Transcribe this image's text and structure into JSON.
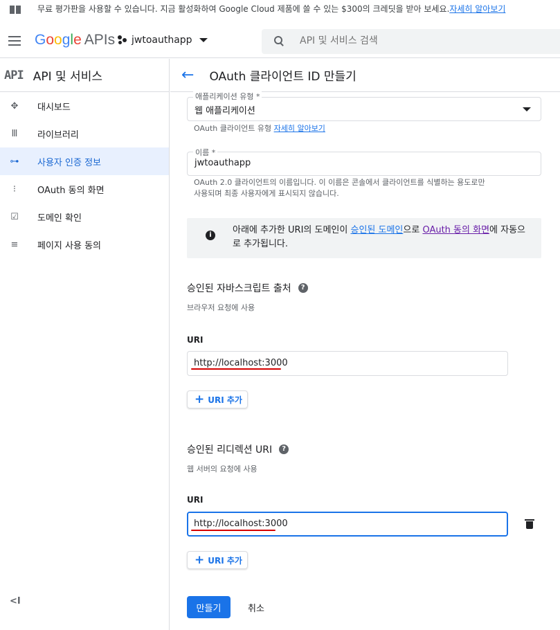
{
  "banner": {
    "message": "무료 평가판을 사용할 수 있습니다. 지금 활성화하여 Google Cloud 제품에 쓸 수 있는 $300의 크레딧을 받아 보세요.",
    "link": "자세히 알아보기"
  },
  "topbar": {
    "logo_apis": "APIs",
    "project_name": "jwtoauthapp",
    "search_placeholder": "API 및 서비스 검색"
  },
  "sidebar": {
    "logo": "API",
    "title": "API 및 서비스",
    "items": [
      {
        "label": "대시보드",
        "icon": "dashboard-icon"
      },
      {
        "label": "라이브러리",
        "icon": "library-icon"
      },
      {
        "label": "사용자 인증 정보",
        "icon": "key-icon",
        "active": true
      },
      {
        "label": "OAuth 동의 화면",
        "icon": "consent-screen-icon"
      },
      {
        "label": "도메인 확인",
        "icon": "domain-verify-icon"
      },
      {
        "label": "페이지 사용 동의",
        "icon": "page-usage-icon"
      }
    ],
    "collapse": "<I"
  },
  "page": {
    "title": "OAuth 클라이언트 ID 만들기"
  },
  "form": {
    "app_type_label": "애플리케이션 유형 *",
    "app_type_value": "웹 애플리케이션",
    "app_type_hint": "OAuth 클라이언트 유형",
    "app_type_hint_link": "자세히 알아보기",
    "name_label": "이름 *",
    "name_value": "jwtoauthapp",
    "name_hint_line1": "OAuth 2.0 클라이언트의 이름입니다. 이 이름은 콘솔에서 클라이언트를 식별하는 용도로만",
    "name_hint_line2": "사용되며 최종 사용자에게 표시되지 않습니다.",
    "info_part1": "아래에 추가한 URI의 도메인이 ",
    "info_link1": "승인된 도메인",
    "info_part2": "으로 ",
    "info_link2": "OAuth 동의 화면",
    "info_part3": "에 자동으로 추가됩니다."
  },
  "js_origins": {
    "title": "승인된 자바스크립트 출처",
    "subtitle": "브라우저 요청에 사용",
    "uri_label": "URI",
    "uri_value": "http://localhost:3000",
    "add_label": "URI 추가"
  },
  "redirect_uris": {
    "title": "승인된 리디렉션 URI",
    "subtitle": "웹 서버의 요청에 사용",
    "uri_label": "URI",
    "uri_value": "http://localhost:3000",
    "add_label": "URI 추가"
  },
  "actions": {
    "create": "만들기",
    "cancel": "취소"
  },
  "colors": {
    "accent": "#1a73e8",
    "annotation": "#d50000"
  }
}
